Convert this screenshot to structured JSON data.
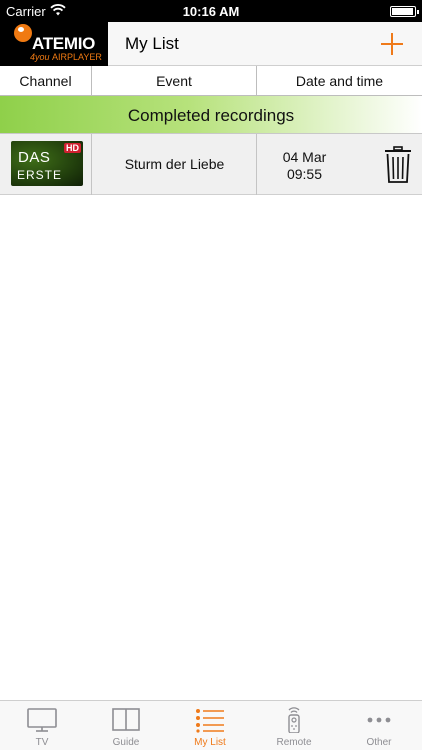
{
  "status_bar": {
    "carrier": "Carrier",
    "time": "10:16 AM",
    "battery_level": 0.95
  },
  "header": {
    "logo_main": "ATEMIO",
    "logo_sub_prefix": "4you",
    "logo_sub_brand": "AIRPLAYER",
    "title": "My List",
    "add_icon": "plus-icon"
  },
  "columns": {
    "channel": "Channel",
    "event": "Event",
    "date_time": "Date and time"
  },
  "section": {
    "title": "Completed recordings"
  },
  "recordings": [
    {
      "channel_logo_top": "DAS",
      "channel_logo_bottom": "ERSTE",
      "channel_badge": "HD",
      "event": "Sturm der Liebe",
      "date": "04 Mar",
      "time": "09:55",
      "delete_icon": "trash-icon"
    }
  ],
  "tabs": [
    {
      "label": "TV",
      "icon": "tv-icon",
      "active": false
    },
    {
      "label": "Guide",
      "icon": "book-icon",
      "active": false
    },
    {
      "label": "My List",
      "icon": "list-icon",
      "active": true
    },
    {
      "label": "Remote",
      "icon": "remote-icon",
      "active": false
    },
    {
      "label": "Other",
      "icon": "more-icon",
      "active": false
    }
  ],
  "colors": {
    "accent": "#ef7a1a",
    "section_green": "#8fd04a",
    "tab_inactive": "#8e8e93"
  }
}
